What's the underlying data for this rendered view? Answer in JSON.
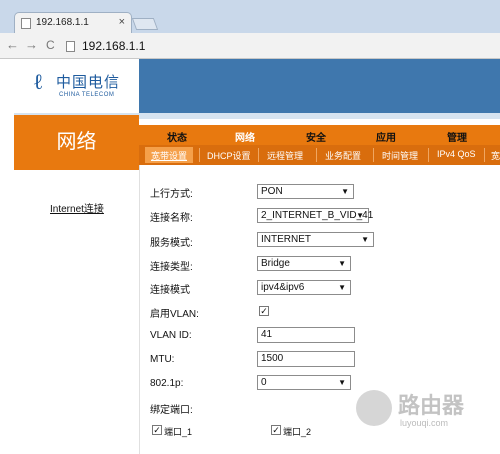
{
  "browser": {
    "tab_title": "192.168.1.1",
    "tab_close": "×",
    "back_glyph": "←",
    "forward_glyph": "→",
    "reload_glyph": "C",
    "url": "192.168.1.1"
  },
  "brand": {
    "logo_mark": "ℓ",
    "logo_cn": "中国电信",
    "logo_en": "CHINA TELECOM"
  },
  "sidebar": {
    "title": "网络",
    "items": [
      {
        "label": "Internet连接"
      }
    ]
  },
  "menu": {
    "items": [
      {
        "label": "状态"
      },
      {
        "label": "网络"
      },
      {
        "label": "安全"
      },
      {
        "label": "应用"
      },
      {
        "label": "管理"
      }
    ],
    "active_index": 1
  },
  "submenu": {
    "items": [
      {
        "label": "宽带设置"
      },
      {
        "label": "DHCP设置"
      },
      {
        "label": "远程管理"
      },
      {
        "label": "业务配置"
      },
      {
        "label": "时间管理"
      },
      {
        "label": "IPv4 QoS"
      },
      {
        "label": "宽"
      }
    ]
  },
  "form": {
    "uplink_label": "上行方式:",
    "uplink_value": "PON",
    "conn_name_label": "连接名称:",
    "conn_name_value": "2_INTERNET_B_VID_41",
    "service_mode_label": "服务模式:",
    "service_mode_value": "INTERNET",
    "conn_type_label": "连接类型:",
    "conn_type_value": "Bridge",
    "conn_mode_label": "连接模式",
    "conn_mode_value": "ipv4&ipv6",
    "vlan_enable_label": "启用VLAN:",
    "vlan_enable_checked": true,
    "vlan_id_label": "VLAN ID:",
    "vlan_id_value": "41",
    "mtu_label": "MTU:",
    "mtu_value": "1500",
    "dot1p_label": "802.1p:",
    "dot1p_value": "0",
    "bind_port_label": "绑定端口:",
    "ports": [
      {
        "label": "端口_1",
        "checked": true
      },
      {
        "label": "端口_2",
        "checked": true
      }
    ]
  },
  "watermark": {
    "text": "路由器",
    "sub": "luyouqi.com"
  },
  "colors": {
    "accent_orange": "#e8790f",
    "header_blue": "#3f77ad"
  }
}
